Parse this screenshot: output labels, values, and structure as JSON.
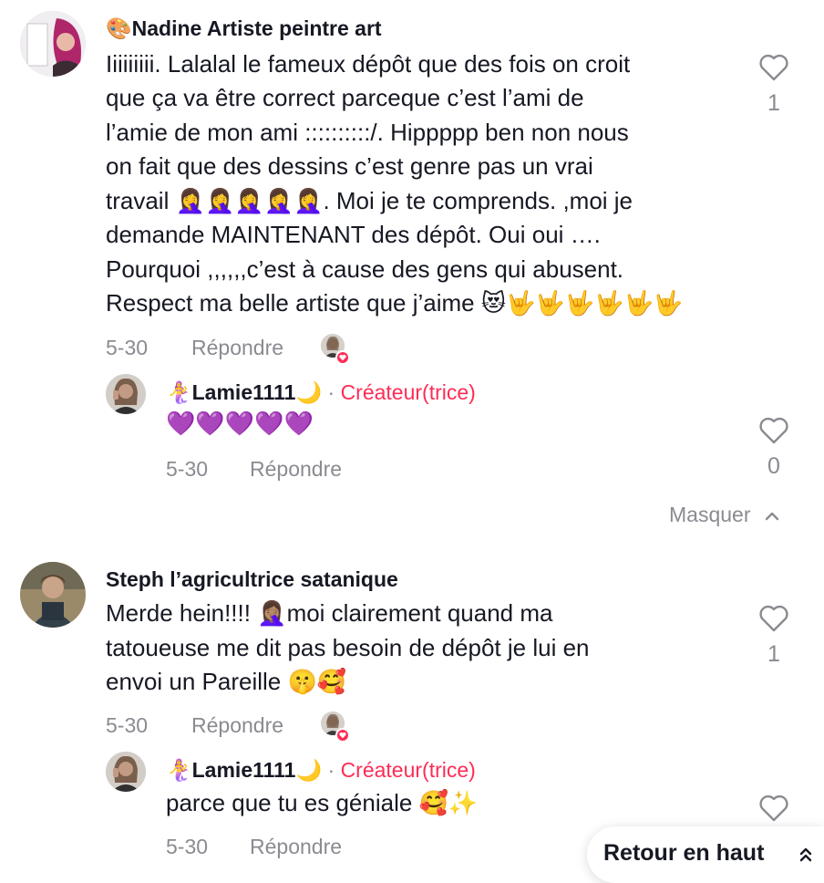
{
  "comments": [
    {
      "author": "🎨Nadine Artiste peintre art",
      "lines": [
        "Iiiiiiiii. Lalalal le fameux dépôt que des fois on croit",
        "que ça va être correct parceque c’est l’ami de",
        "l’amie de mon ami ::::::::::/. Hippppp ben non nous",
        "on fait que des dessins c’est genre pas un vrai",
        "travail 🤦‍♀️🤦‍♀️🤦‍♀️🤦‍♀️🤦‍♀️. Moi je te comprends. ,moi je",
        "demande MAINTENANT des dépôt. Oui oui ….",
        "Pourquoi ,,,,,,c’est à cause des gens qui abusent.",
        "Respect ma belle artiste que j’aime 😻🤟🤟🤟🤟🤟🤟"
      ],
      "date": "5-30",
      "reply_label": "Répondre",
      "like_count": "1",
      "reply": {
        "author": "🧜‍♀️Lamie1111🌙",
        "separator": "·",
        "badge": "Créateur(trice)",
        "text": "💜💜💜💜💜",
        "date": "5-30",
        "reply_label": "Répondre",
        "like_count": "0"
      }
    },
    {
      "author": "Steph l’agricultrice satanique",
      "lines": [
        "Merde hein!!!! 🤦🏽‍♀️moi clairement quand ma",
        "tatoueuse me dit pas besoin de dépôt je lui en",
        "envoi un Pareille 🤫🥰"
      ],
      "date": "5-30",
      "reply_label": "Répondre",
      "like_count": "1",
      "reply": {
        "author": "🧜‍♀️Lamie1111🌙",
        "separator": "·",
        "badge": "Créateur(trice)",
        "text": "parce que tu es géniale 🥰✨",
        "date": "5-30",
        "reply_label": "Répondre"
      }
    }
  ],
  "hide_label": "Masquer",
  "back_to_top": "Retour en haut",
  "colors": {
    "creator": "#fe2c55",
    "meta": "#8a8b91",
    "text": "#161823"
  },
  "icons": {
    "like": "heart-outline-icon",
    "hide": "chevron-up-icon",
    "back_to_top": "double-chevron-up-icon",
    "liked_by_creator": "creator-heart-badge-icon"
  }
}
